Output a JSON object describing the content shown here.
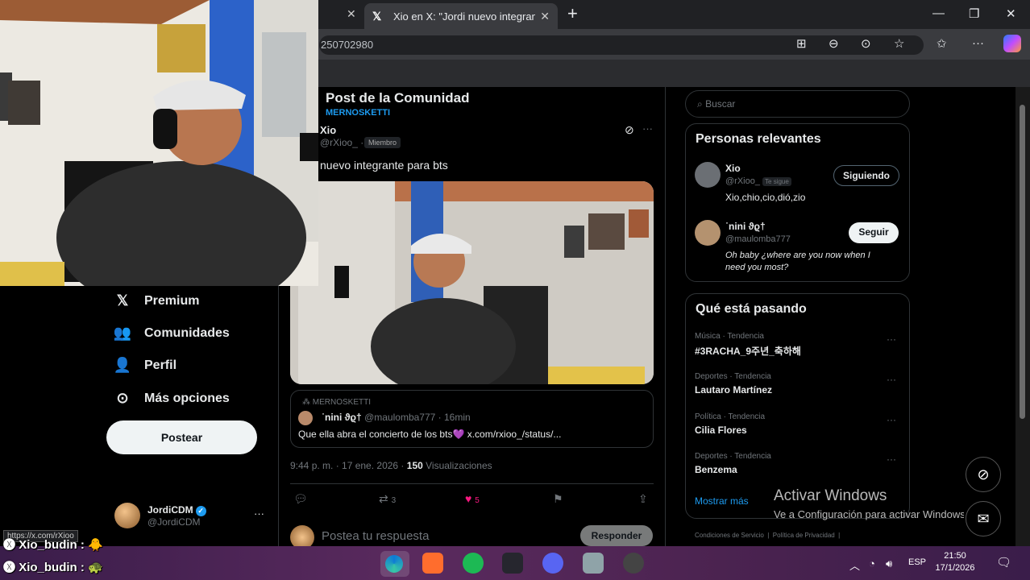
{
  "browser": {
    "tab_title": "Xio en X: \"Jordi nuevo integrante",
    "url_partial": "250702980",
    "new_tab_label": "+"
  },
  "nav": {
    "items": [
      {
        "label": "Premium",
        "icon": "x-logo-icon"
      },
      {
        "label": "Comunidades",
        "icon": "communities-icon"
      },
      {
        "label": "Perfil",
        "icon": "profile-icon"
      },
      {
        "label": "Más opciones",
        "icon": "more-options-icon"
      }
    ],
    "post_button": "Postear",
    "account_name": "JordiCDM",
    "account_handle": "@JordiCDM",
    "url_tooltip": "https://x.com/rXioo"
  },
  "post": {
    "header_title": "Post de la Comunidad",
    "header_sub": "MERNOSKETTI",
    "author_name": "Xio",
    "author_handle": "@rXioo_ ·",
    "member_badge": "Miembro",
    "text": "nuevo integrante para bts",
    "quote_community": "MERNOSKETTI",
    "quote_author": "˙nini ϑϱ†",
    "quote_handle": "@maulomba777 · 16min",
    "quote_text": "Que ella abra el concierto de los bts💜 x.com/rxioo_/status/...",
    "meta_time": "9:44 p. m. · 17 ene. 2026 · ",
    "meta_views_count": "150",
    "meta_views_label": " Visualizaciones",
    "retweets": "3",
    "likes": "5",
    "reply_placeholder": "Postea tu respuesta",
    "reply_button": "Responder"
  },
  "sidebar": {
    "search_placeholder": "Buscar",
    "relevant_title": "Personas relevantes",
    "people": [
      {
        "name": "Xio",
        "handle": "@rXioo_",
        "badge": "Te sigue",
        "bio": "Xio,chio,cio,dió,zio",
        "button": "Siguiendo"
      },
      {
        "name": "˙nini ϑϱ†",
        "handle": "@maulomba777",
        "bio": "Oh baby ¿where are you now when I need you most?",
        "button": "Seguir"
      }
    ],
    "trends_title": "Qué está pasando",
    "trends": [
      {
        "category": "Música · Tendencia",
        "name": "#3RACHA_9주년_축하해"
      },
      {
        "category": "Deportes · Tendencia",
        "name": "Lautaro Martínez"
      },
      {
        "category": "Política · Tendencia",
        "name": "Cilia Flores"
      },
      {
        "category": "Deportes · Tendencia",
        "name": "Benzema"
      }
    ],
    "show_more": "Mostrar más",
    "footer_terms": "Condiciones de Servicio",
    "footer_privacy": "Política de Privacidad"
  },
  "overlay": {
    "activate_title": "Activar Windows",
    "activate_sub": "Ve a Configuración para activar Windows.",
    "chat": [
      {
        "user": "Xio_budin :"
      },
      {
        "user": "Xio_budin :"
      }
    ]
  },
  "taskbar": {
    "lang": "ESP",
    "time": "21:50",
    "date": "17/1/2026"
  },
  "colors": {
    "accent": "#1d9bf0",
    "like": "#f91880",
    "bg": "#000000"
  }
}
